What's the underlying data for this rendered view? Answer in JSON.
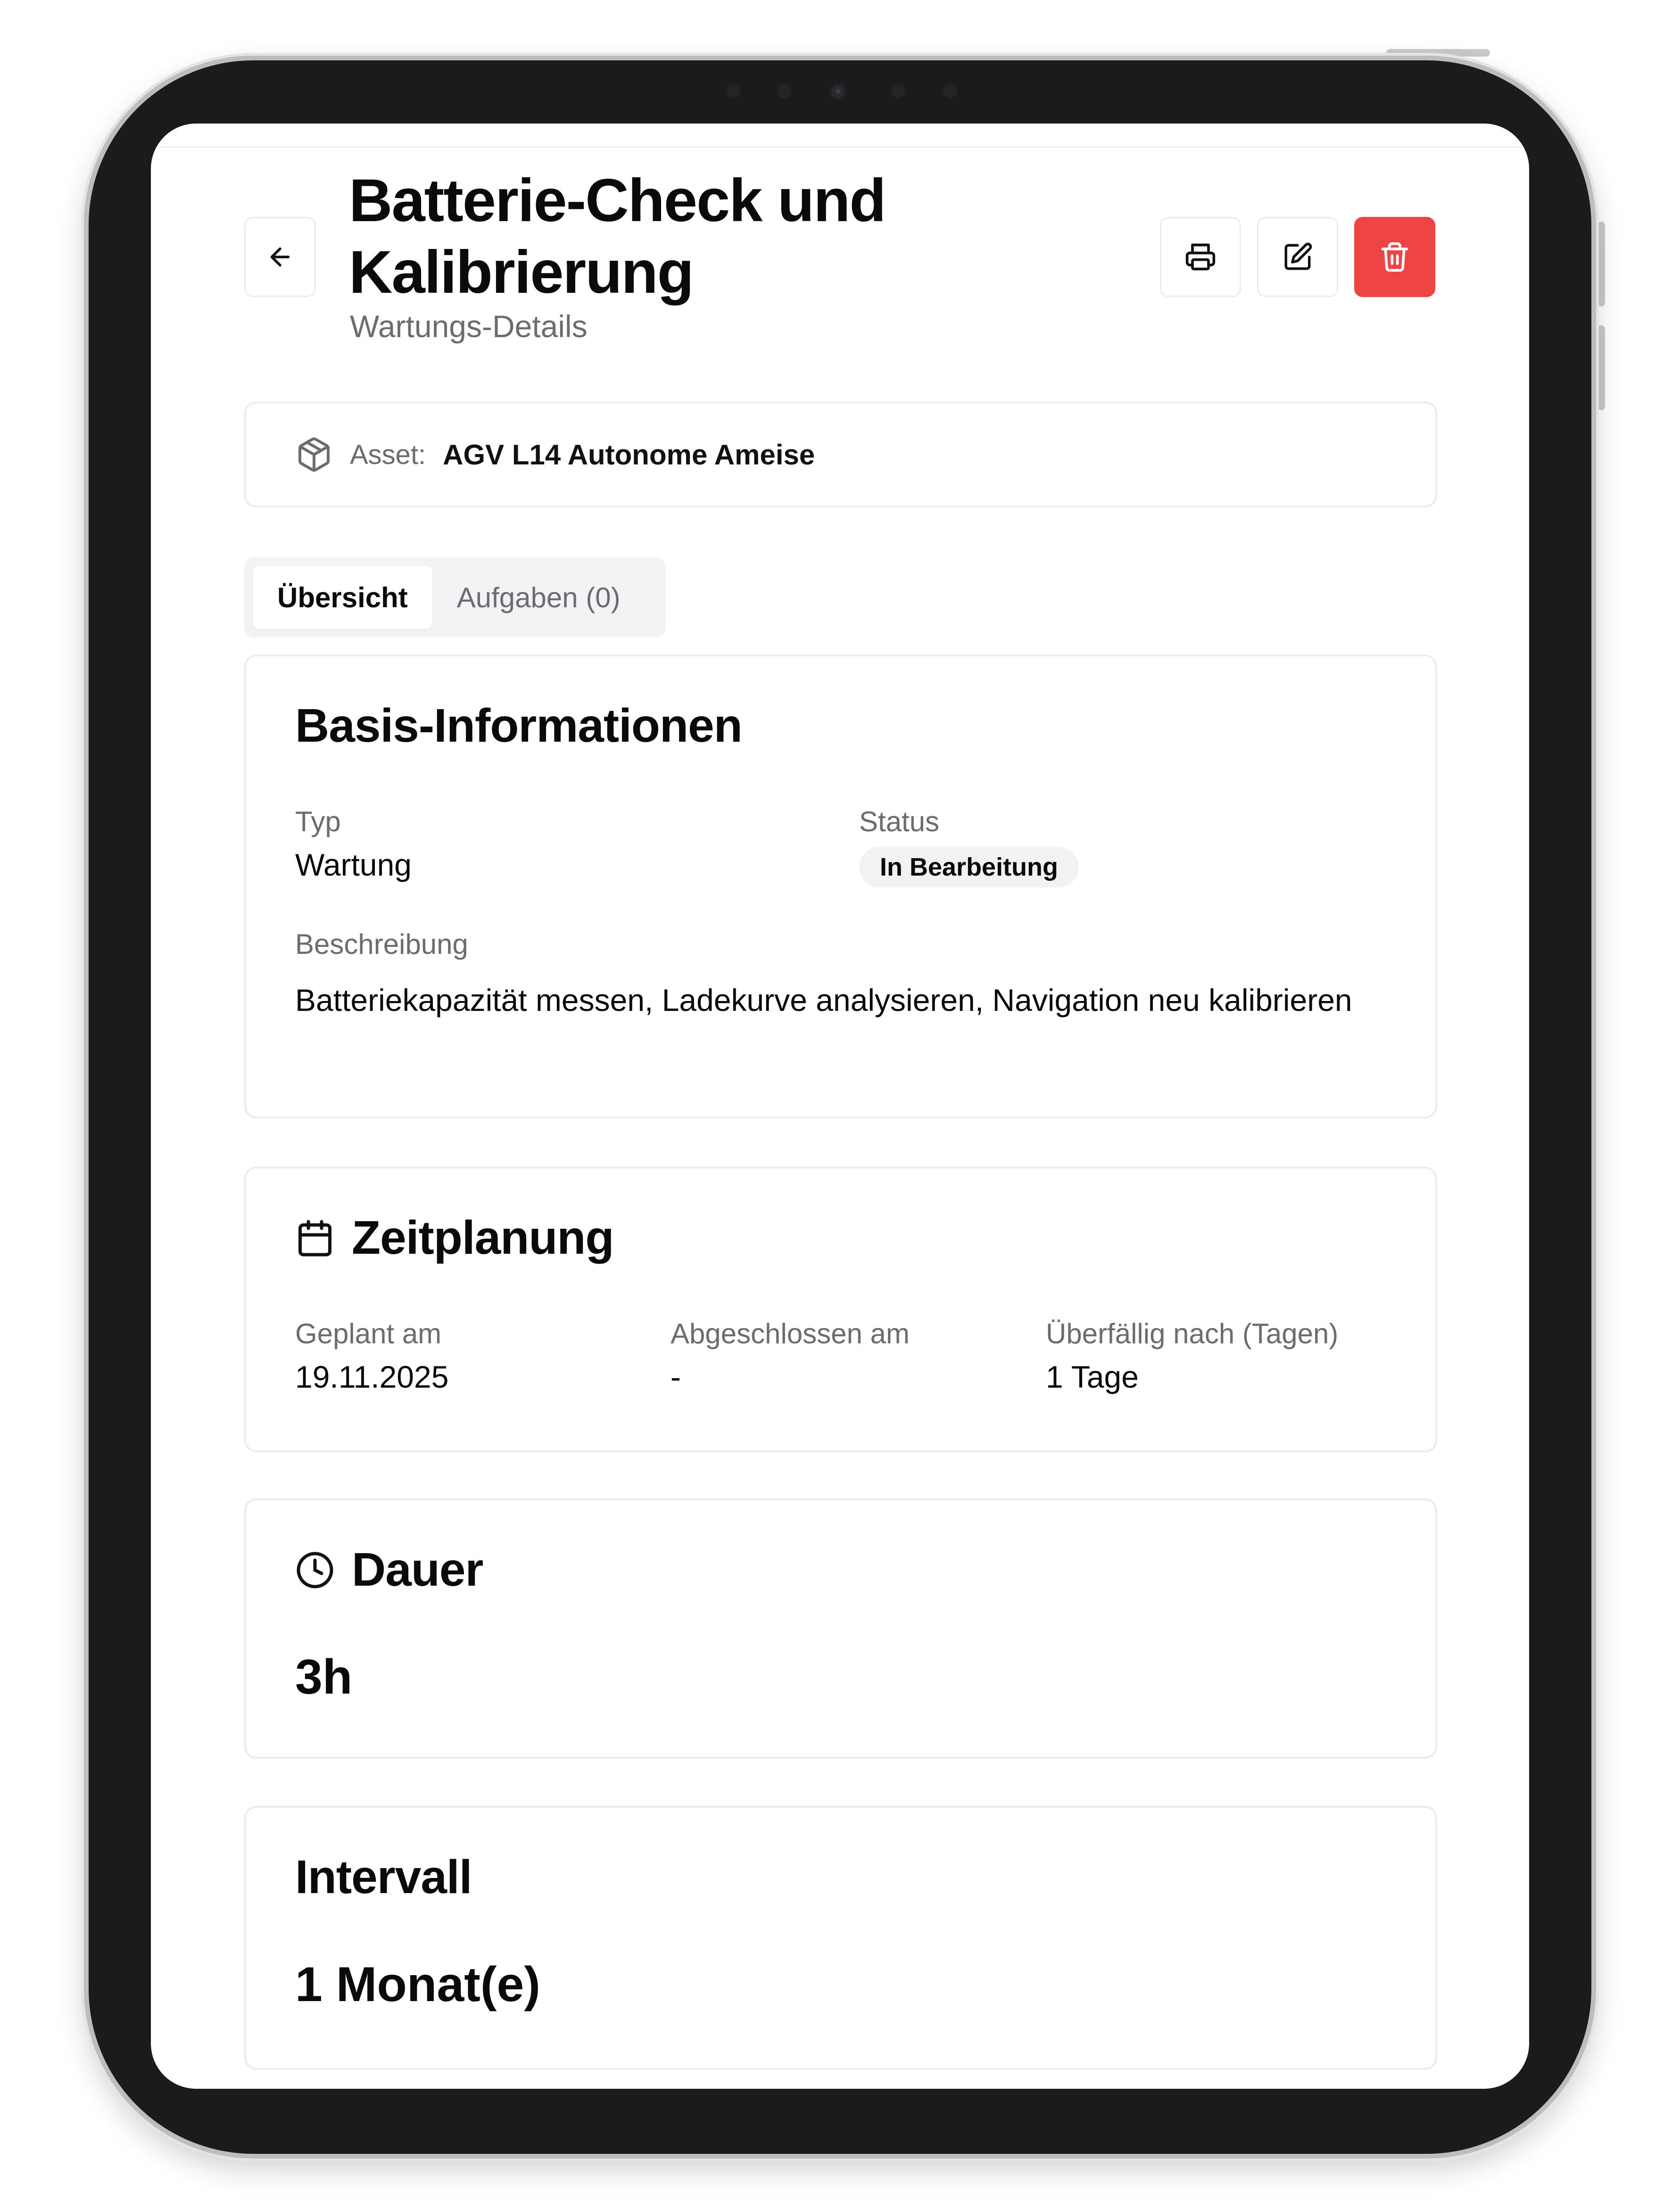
{
  "header": {
    "title": "Batterie-Check und Kalibrierung",
    "subtitle": "Wartungs-Details"
  },
  "actions": {
    "print_icon": "printer-icon",
    "edit_icon": "edit-icon",
    "delete_icon": "trash-icon",
    "delete_color": "#ef4444"
  },
  "asset": {
    "label": "Asset:",
    "value": "AGV L14 Autonome Ameise"
  },
  "tabs": [
    {
      "label": "Übersicht",
      "active": true
    },
    {
      "label": "Aufgaben (0)",
      "active": false
    }
  ],
  "basis": {
    "title": "Basis-Informationen",
    "typ_label": "Typ",
    "typ_value": "Wartung",
    "status_label": "Status",
    "status_value": "In Bearbeitung",
    "beschreibung_label": "Beschreibung",
    "beschreibung_value": "Batteriekapazität messen, Ladekurve analysieren, Navigation neu kalibrieren"
  },
  "zeitplanung": {
    "title": "Zeitplanung",
    "geplant_label": "Geplant am",
    "geplant_value": "19.11.2025",
    "abgeschlossen_label": "Abgeschlossen am",
    "abgeschlossen_value": "-",
    "ueberfaellig_label": "Überfällig nach (Tagen)",
    "ueberfaellig_value": "1 Tage"
  },
  "dauer": {
    "title": "Dauer",
    "value": "3h"
  },
  "intervall": {
    "title": "Intervall",
    "value": "1 Monat(e)"
  }
}
